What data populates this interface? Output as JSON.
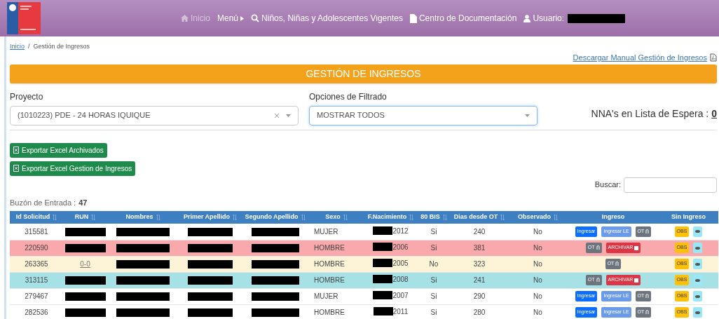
{
  "navbar": {
    "items": [
      {
        "kind": "home",
        "label": "Inicio"
      },
      {
        "kind": "menu",
        "label": "Menú"
      },
      {
        "kind": "search",
        "label": "Niños, Niñas y Adolescentes Vigentes"
      },
      {
        "kind": "doc",
        "label": "Centro de Documentación"
      },
      {
        "kind": "user",
        "label": "Usuario:",
        "redacted": true
      }
    ]
  },
  "breadcrumb_separator": "/",
  "breadcrumb": [
    {
      "label": "Inicio",
      "link": true
    },
    {
      "label": "Gestión de Ingresos",
      "link": false
    }
  ],
  "manual_link": "Descargar Manual Gestión de Ingresos",
  "banner": "GESTIÓN DE INGRESOS",
  "filters": [
    {
      "label": "Proyecto",
      "value": "(1010223) PDE - 24 HORAS IQUIQUE",
      "clearable": true,
      "focused": false
    },
    {
      "label": "Opciones de Filtrado",
      "value": "MOSTRAR TODOS",
      "clearable": false,
      "focused": true
    }
  ],
  "waitlist": {
    "label": "NNA's en Lista de Espera :",
    "count": "0"
  },
  "export_buttons": [
    "Exportar Excel Archivados",
    "Exportar Excel Gestion de Ingresos"
  ],
  "search": {
    "label": "Buscar:"
  },
  "inbox": {
    "label": "Buzón de Entrada :",
    "count": "47"
  },
  "table": {
    "columns": [
      {
        "label": "Id Solicitud",
        "sortable": true
      },
      {
        "label": "RUN",
        "sortable": true
      },
      {
        "label": "Nombres",
        "sortable": true
      },
      {
        "label": "Primer Apellido",
        "sortable": true
      },
      {
        "label": "Segundo Apellido",
        "sortable": true
      },
      {
        "label": "Sexo",
        "sortable": true
      },
      {
        "label": "F.Nacimiento",
        "sortable": true
      },
      {
        "label": "80 BIS",
        "sortable": true
      },
      {
        "label": "Dias desde OT",
        "sortable": true
      },
      {
        "label": "Observado",
        "sortable": true
      },
      {
        "label": "Ingreso",
        "sortable": false
      },
      {
        "label": "Sin Ingreso",
        "sortable": false
      }
    ],
    "rows": [
      {
        "color": "#ffffff",
        "id": "315581",
        "run": {
          "redacted": true
        },
        "nombres": {
          "redacted": true
        },
        "primer": {
          "redacted": true
        },
        "segundo": {
          "redacted": true
        },
        "sexo": "MUJER",
        "birth": "2012",
        "bis": "Si",
        "dias": "240",
        "observado": "No",
        "actions": [
          {
            "kind": "ingresar",
            "label": "Ingresar"
          },
          {
            "kind": "ingresar_le",
            "label": "Ingresar LE"
          },
          {
            "kind": "ot",
            "label": "OT"
          }
        ],
        "obs": "OBS"
      },
      {
        "color": "#f9a8ac",
        "id": "220590",
        "run": {
          "redacted": true
        },
        "nombres": {
          "redacted": true
        },
        "primer": {
          "redacted": true
        },
        "segundo": {
          "redacted": true
        },
        "sexo": "HOMBRE",
        "birth": "2006",
        "bis": "Si",
        "dias": "381",
        "observado": "No",
        "actions": [
          {
            "kind": "ot",
            "label": "OT"
          },
          {
            "kind": "archivar",
            "label": "ARCHIVAR"
          }
        ],
        "obs": "OBS"
      },
      {
        "color": "#fdf3d6",
        "id": "263365",
        "run": {
          "redacted": false,
          "text": "0-0"
        },
        "nombres": {
          "redacted": true
        },
        "primer": {
          "redacted": true
        },
        "segundo": {
          "redacted": true
        },
        "sexo": "HOMBRE",
        "birth": "2005",
        "bis": "No",
        "dias": "323",
        "observado": "No",
        "actions": [
          {
            "kind": "ot",
            "label": "OT"
          }
        ],
        "obs": "OBS"
      },
      {
        "color": "#a6e1e6",
        "id": "313115",
        "run": {
          "redacted": true
        },
        "nombres": {
          "redacted": true
        },
        "primer": {
          "redacted": true
        },
        "segundo": {
          "redacted": true
        },
        "sexo": "HOMBRE",
        "birth": "2008",
        "bis": "Si",
        "dias": "241",
        "observado": "No",
        "actions": [
          {
            "kind": "ot",
            "label": "OT"
          },
          {
            "kind": "archivar",
            "label": "ARCHIVAR"
          }
        ],
        "obs": "OBS"
      },
      {
        "color": "#ffffff",
        "id": "279467",
        "run": {
          "redacted": true
        },
        "nombres": {
          "redacted": true
        },
        "primer": {
          "redacted": true
        },
        "segundo": {
          "redacted": true
        },
        "sexo": "MUJER",
        "birth": "2007",
        "bis": "Si",
        "dias": "290",
        "observado": "No",
        "actions": [
          {
            "kind": "ingresar",
            "label": "Ingresar"
          },
          {
            "kind": "ingresar_le",
            "label": "Ingresar LE"
          },
          {
            "kind": "ot",
            "label": "OT"
          }
        ],
        "obs": "OBS"
      },
      {
        "color": "#ffffff",
        "id": "282536",
        "run": {
          "redacted": true
        },
        "nombres": {
          "redacted": true
        },
        "primer": {
          "redacted": true
        },
        "segundo": {
          "redacted": true
        },
        "sexo": "HOMBRE",
        "birth": "2011",
        "bis": "Si",
        "dias": "280",
        "observado": "No",
        "actions": [
          {
            "kind": "ingresar",
            "label": "Ingresar"
          },
          {
            "kind": "ingresar_le",
            "label": "Ingresar LE"
          },
          {
            "kind": "ot",
            "label": "OT"
          }
        ],
        "obs": "OBS"
      }
    ]
  }
}
